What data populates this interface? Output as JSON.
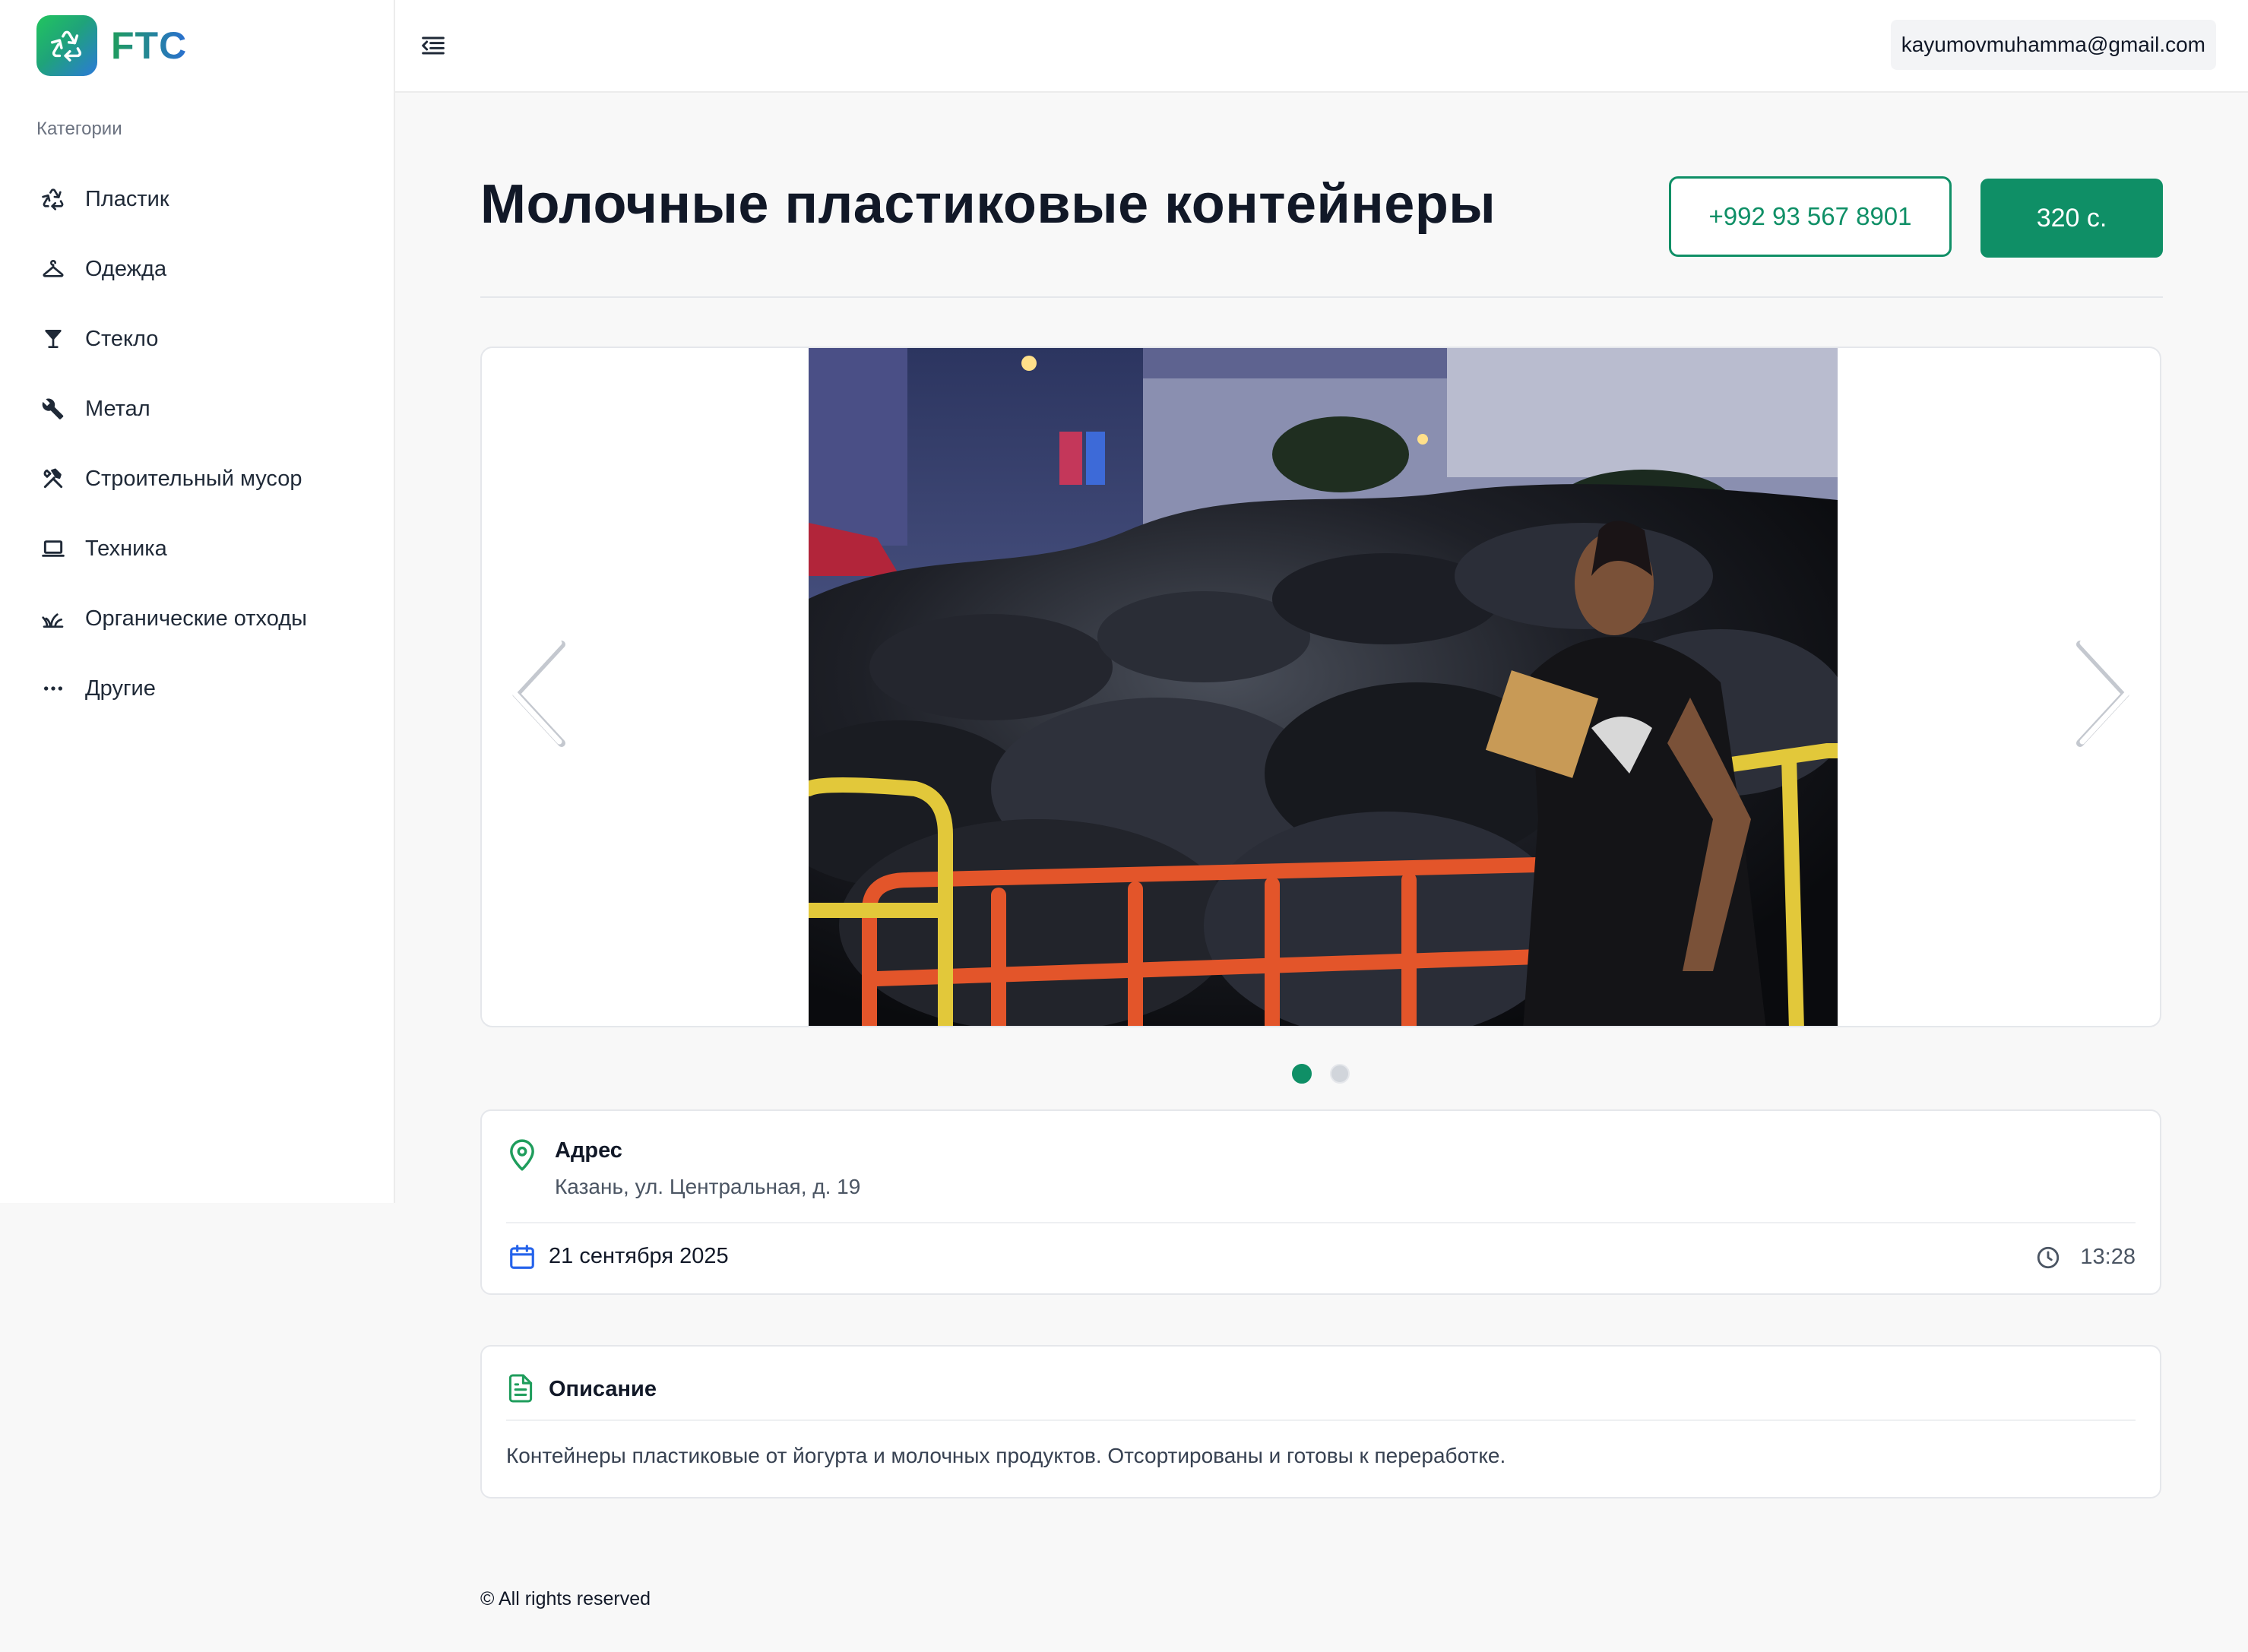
{
  "brand": {
    "name": "FTC",
    "colors": {
      "accent": "#0f8f66",
      "gradient_start": "#22c55e",
      "gradient_end": "#2b7ad8"
    }
  },
  "sidebar": {
    "heading": "Категории",
    "items": [
      {
        "label": "Пластик",
        "icon": "recycle-icon"
      },
      {
        "label": "Одежда",
        "icon": "hanger-icon"
      },
      {
        "label": "Стекло",
        "icon": "glass-icon"
      },
      {
        "label": "Метал",
        "icon": "wrench-icon"
      },
      {
        "label": "Строительный мусор",
        "icon": "tools-icon"
      },
      {
        "label": "Техника",
        "icon": "laptop-icon"
      },
      {
        "label": "Органические отходы",
        "icon": "grass-icon"
      },
      {
        "label": "Другие",
        "icon": "more-icon"
      }
    ]
  },
  "topbar": {
    "email": "kayumovmuhamma@gmail.com"
  },
  "listing": {
    "title": "Молочные пластиковые контейнеры",
    "phone": "+992 93 567 8901",
    "price": "320 с.",
    "carousel": {
      "slides": 2,
      "active_slide": 1
    },
    "address_label": "Адрес",
    "address": "Казань, ул. Центральная, д. 19",
    "date": "21 сентября 2025",
    "time": "13:28",
    "description_label": "Описание",
    "description": "Контейнеры пластиковые от йогурта и молочных продуктов. Отсортированы и готовы к переработке."
  },
  "footer": {
    "text": "© All rights reserved"
  }
}
